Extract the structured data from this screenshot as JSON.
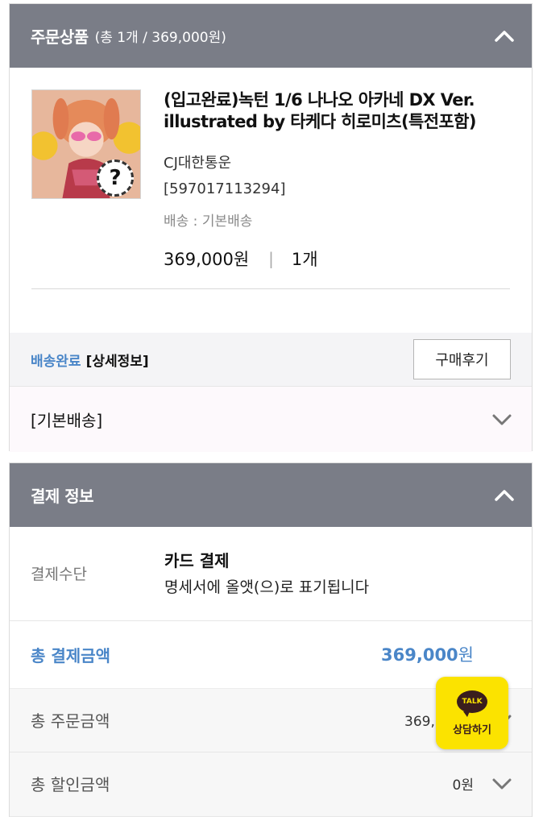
{
  "order_section": {
    "title": "주문상품",
    "summary": "(총 1개 / 369,000원)",
    "collapse_icon": "chevron-up-icon",
    "product": {
      "name": "(입고완료)녹턴 1/6 나나오 아카네 DX Ver. illustrated by 타케다 히로미츠(특전포함)",
      "courier": "CJ대한통운",
      "tracking": "[597017113294]",
      "shipping": "배송 : 기본배송",
      "price": "369,000원",
      "separator": "|",
      "quantity": "1개",
      "thumbnail_badge": "?"
    },
    "status": {
      "state": "배송완료",
      "detail_link": "[상세정보]",
      "review_button": "구매후기"
    },
    "shipping_row": {
      "label": "[기본배송]",
      "icon": "chevron-down-icon"
    }
  },
  "payment_section": {
    "title": "결제 정보",
    "collapse_icon": "chevron-up-icon",
    "method": {
      "label": "결제수단",
      "type": "카드 결제",
      "note": "명세서에 올앳(으)로 표기됩니다"
    },
    "total": {
      "label": "총 결제금액",
      "amount": "369,000",
      "unit": "원"
    },
    "rows": [
      {
        "label": "총 주문금액",
        "value": "369,000원"
      },
      {
        "label": "총 할인금액",
        "value": "0원"
      }
    ]
  },
  "kakao_talk": {
    "bubble": "TALK",
    "label": "상담하기",
    "color": "#fbe300"
  },
  "colors": {
    "header_bg": "#7a7d87",
    "accent_blue": "#4a86c8"
  }
}
